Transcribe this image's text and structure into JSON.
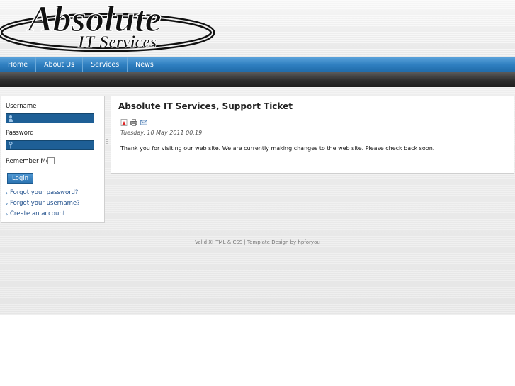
{
  "header": {
    "logo_line1": "Absolute",
    "logo_line2": "IT Services"
  },
  "nav": {
    "items": [
      {
        "label": "Home"
      },
      {
        "label": "About Us"
      },
      {
        "label": "Services"
      },
      {
        "label": "News"
      }
    ]
  },
  "login": {
    "username_label": "Username",
    "username_value": "",
    "password_label": "Password",
    "password_value": "",
    "remember_label": "Remember Me",
    "remember_checked": false,
    "login_button": "Login",
    "links": [
      {
        "label": "Forgot your password?"
      },
      {
        "label": "Forgot your username?"
      },
      {
        "label": "Create an account"
      }
    ]
  },
  "article": {
    "title": "Absolute IT Services, Support Ticket",
    "icons": [
      "pdf-icon",
      "print-icon",
      "email-icon"
    ],
    "date": "Tuesday, 10 May 2011 00:19",
    "body": "Thank you for visiting our web site.  We are currently making changes to the web site.  Please check back soon."
  },
  "footer": {
    "text": "Valid XHTML & CSS | Template Design by hpforyou"
  },
  "colors": {
    "nav_blue": "#2f7fc0",
    "field_blue": "#1e5f96",
    "dark_bar": "#2e2e2e",
    "link_blue": "#1d4d8a"
  }
}
